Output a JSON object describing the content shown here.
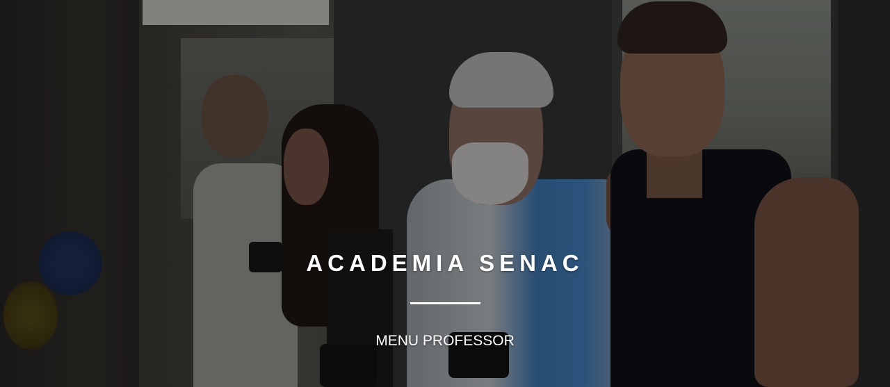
{
  "hero": {
    "title": "ACADEMIA SENAC",
    "menu_link_label": "MENU PROFESSOR",
    "background_image": "gym-trainers-photo",
    "text_color": "#ffffff",
    "overlay_color": "#000000"
  }
}
